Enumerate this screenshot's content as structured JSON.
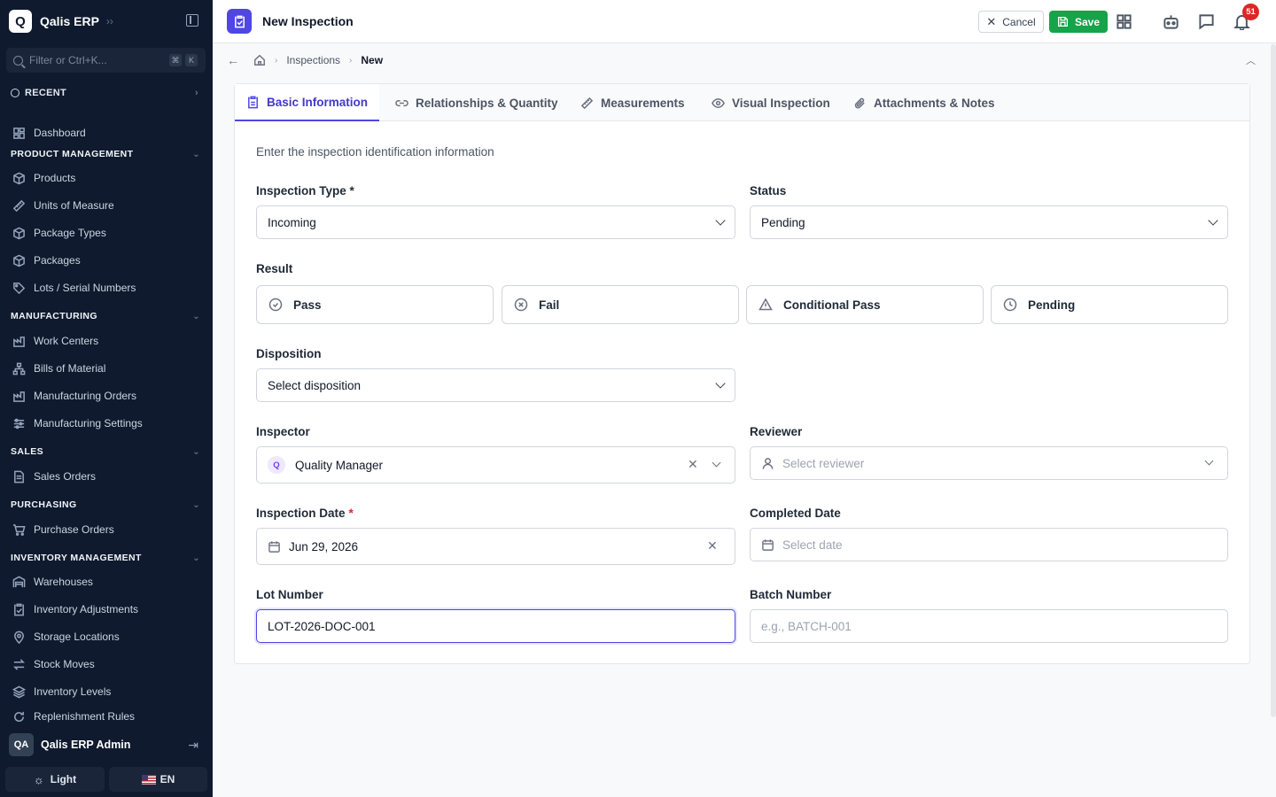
{
  "app": {
    "logo_letter": "Q",
    "name": "Qalis ERP"
  },
  "sidebar": {
    "filter_placeholder": "Filter or Ctrl+K...",
    "kbd1": "⌘",
    "kbd2": "K",
    "recent_label": "RECENT",
    "dashboard": "Dashboard",
    "sections": {
      "product": "PRODUCT MANAGEMENT",
      "manufacturing": "MANUFACTURING",
      "sales": "SALES",
      "purchasing": "PURCHASING",
      "inventory": "INVENTORY MANAGEMENT"
    },
    "items": {
      "products": "Products",
      "uom": "Units of Measure",
      "package_types": "Package Types",
      "packages": "Packages",
      "lots": "Lots / Serial Numbers",
      "work_centers": "Work Centers",
      "bom": "Bills of Material",
      "mfg_orders": "Manufacturing Orders",
      "mfg_settings": "Manufacturing Settings",
      "sales_orders": "Sales Orders",
      "purchase_orders": "Purchase Orders",
      "warehouses": "Warehouses",
      "inv_adjustments": "Inventory Adjustments",
      "storage_locations": "Storage Locations",
      "stock_moves": "Stock Moves",
      "inv_levels": "Inventory Levels",
      "replenishment": "Replenishment Rules"
    },
    "user_initials": "QA",
    "user_name": "Qalis ERP Admin",
    "theme_label": "Light",
    "lang_label": "EN"
  },
  "header": {
    "title": "New Inspection",
    "cancel_label": "Cancel",
    "save_label": "Save",
    "notification_count": "51"
  },
  "breadcrumb": {
    "parent": "Inspections",
    "current": "New"
  },
  "tabs": {
    "basic": "Basic Information",
    "relationships": "Relationships & Quantity",
    "measurements": "Measurements",
    "visual": "Visual Inspection",
    "attachments": "Attachments & Notes"
  },
  "form": {
    "intro": "Enter the inspection identification information",
    "inspection_type_label": "Inspection Type *",
    "inspection_type_value": "Incoming",
    "status_label": "Status",
    "status_value": "Pending",
    "result_label": "Result",
    "result_options": [
      "Pass",
      "Fail",
      "Conditional Pass",
      "Pending"
    ],
    "disposition_label": "Disposition",
    "disposition_placeholder": "Select disposition",
    "inspector_label": "Inspector",
    "inspector_initial": "Q",
    "inspector_value": "Quality Manager",
    "reviewer_label": "Reviewer",
    "reviewer_placeholder": "Select reviewer",
    "inspection_date_label": "Inspection Date",
    "inspection_date_req": "*",
    "inspection_date_value": "Jun 29, 2026",
    "completed_date_label": "Completed Date",
    "completed_date_placeholder": "Select date",
    "lot_label": "Lot Number",
    "lot_value": "LOT-2026-DOC-001",
    "batch_label": "Batch Number",
    "batch_placeholder": "e.g., BATCH-001"
  }
}
